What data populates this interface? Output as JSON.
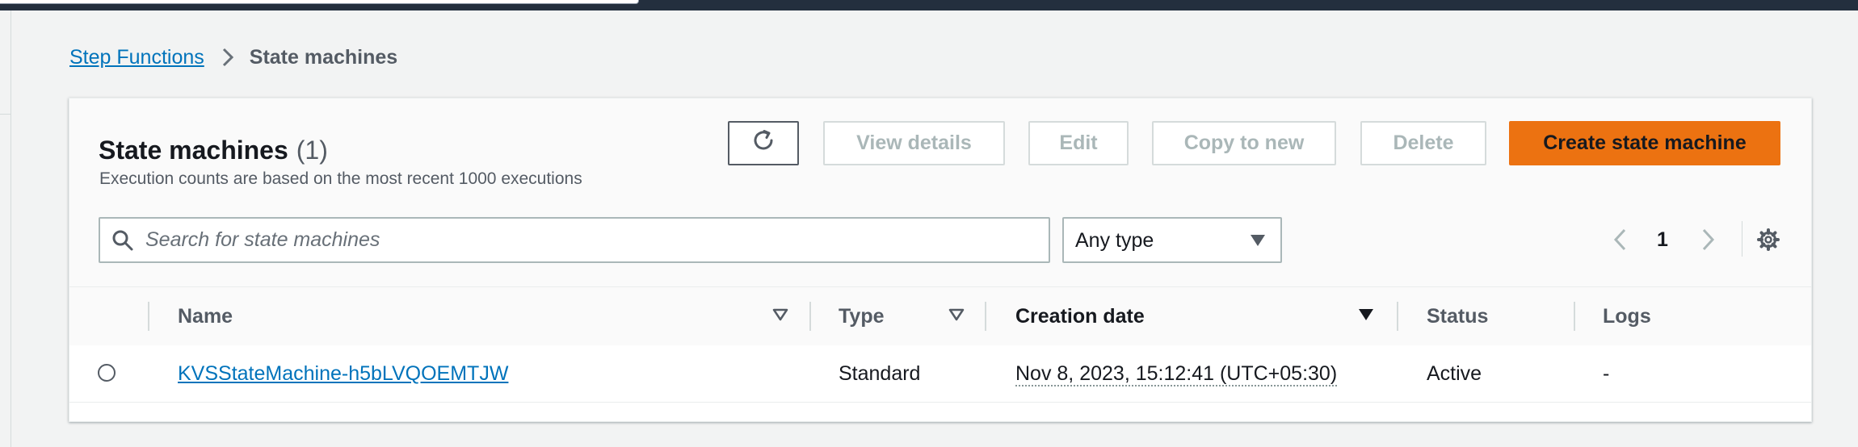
{
  "breadcrumb": {
    "parent": "Step Functions",
    "current": "State machines"
  },
  "panel": {
    "title": "State machines",
    "count": "(1)",
    "description": "Execution counts are based on the most recent 1000 executions"
  },
  "toolbar": {
    "refresh_icon": "refresh-icon",
    "view_details": "View details",
    "edit": "Edit",
    "copy_to_new": "Copy to new",
    "delete": "Delete",
    "create": "Create state machine"
  },
  "search": {
    "placeholder": "Search for state machines",
    "value": ""
  },
  "type_filter": {
    "selected": "Any type"
  },
  "pagination": {
    "page": "1"
  },
  "table": {
    "columns": {
      "name": "Name",
      "type": "Type",
      "creation_date": "Creation date",
      "status": "Status",
      "logs": "Logs"
    },
    "rows": [
      {
        "name": "KVSStateMachine-h5bLVQOEMTJW",
        "type": "Standard",
        "creation_date": "Nov 8, 2023, 15:12:41 (UTC+05:30)",
        "status": "Active",
        "logs": "-"
      }
    ]
  },
  "colors": {
    "link": "#0073bb",
    "primary": "#ec7211",
    "topbar": "#232f3e",
    "page_bg": "#f2f3f3"
  }
}
